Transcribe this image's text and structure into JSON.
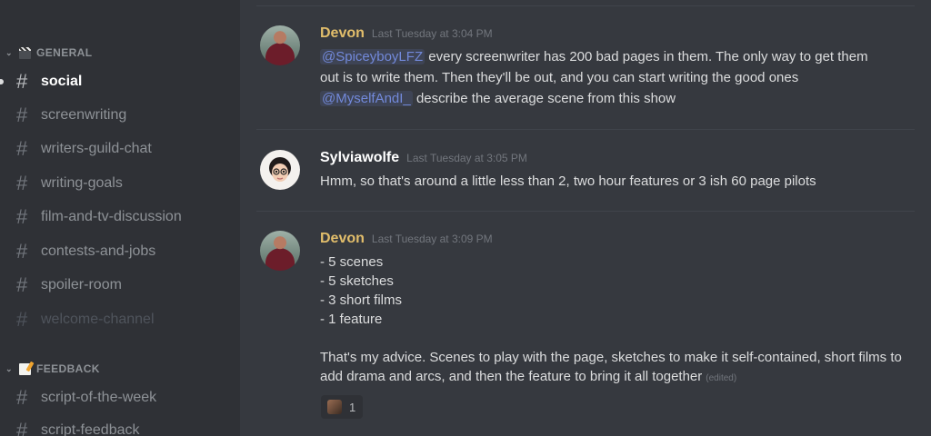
{
  "sidebar": {
    "categories": [
      {
        "label": "GENERAL",
        "emoji": "clapper-board-icon"
      },
      {
        "label": "FEEDBACK",
        "emoji": "memo-icon"
      }
    ],
    "channels": [
      {
        "name": "social",
        "state": "active"
      },
      {
        "name": "screenwriting",
        "state": "normal"
      },
      {
        "name": "writers-guild-chat",
        "state": "normal"
      },
      {
        "name": "writing-goals",
        "state": "normal"
      },
      {
        "name": "film-and-tv-discussion",
        "state": "normal"
      },
      {
        "name": "contests-and-jobs",
        "state": "normal"
      },
      {
        "name": "spoiler-room",
        "state": "normal"
      },
      {
        "name": "welcome-channel",
        "state": "muted"
      },
      {
        "name": "script-of-the-week",
        "state": "normal"
      },
      {
        "name": "script-feedback",
        "state": "normal"
      }
    ]
  },
  "messages": [
    {
      "author": "Devon",
      "author_color": "#e2be6b",
      "timestamp": "Last Tuesday at 3:04 PM",
      "mention1": "@SpiceyboyLFZ",
      "line1": "every screenwriter has 200 bad pages in them. The only way to get them",
      "line2": "out is to write them. Then they'll be out, and you can start writing the good ones",
      "mention2": "@MyselfAndI_",
      "line3": "describe the average scene from this show"
    },
    {
      "author": "Sylviawolfe",
      "author_color": "#ffffff",
      "timestamp": "Last Tuesday at 3:05 PM",
      "line1": "Hmm, so that's around a little less than 2, two hour features or 3 ish 60 page pilots"
    },
    {
      "author": "Devon",
      "author_color": "#e2be6b",
      "timestamp": "Last Tuesday at 3:09 PM",
      "list": [
        "- 5 scenes",
        "- 5 sketches",
        "- 3 short films",
        "- 1 feature"
      ],
      "line1": "That's my advice. Scenes to play with the page, sketches to make it self-contained, short films to",
      "line2": "add drama and arcs, and then the feature to bring it all together",
      "edited": "(edited)",
      "reaction_count": "1"
    }
  ]
}
